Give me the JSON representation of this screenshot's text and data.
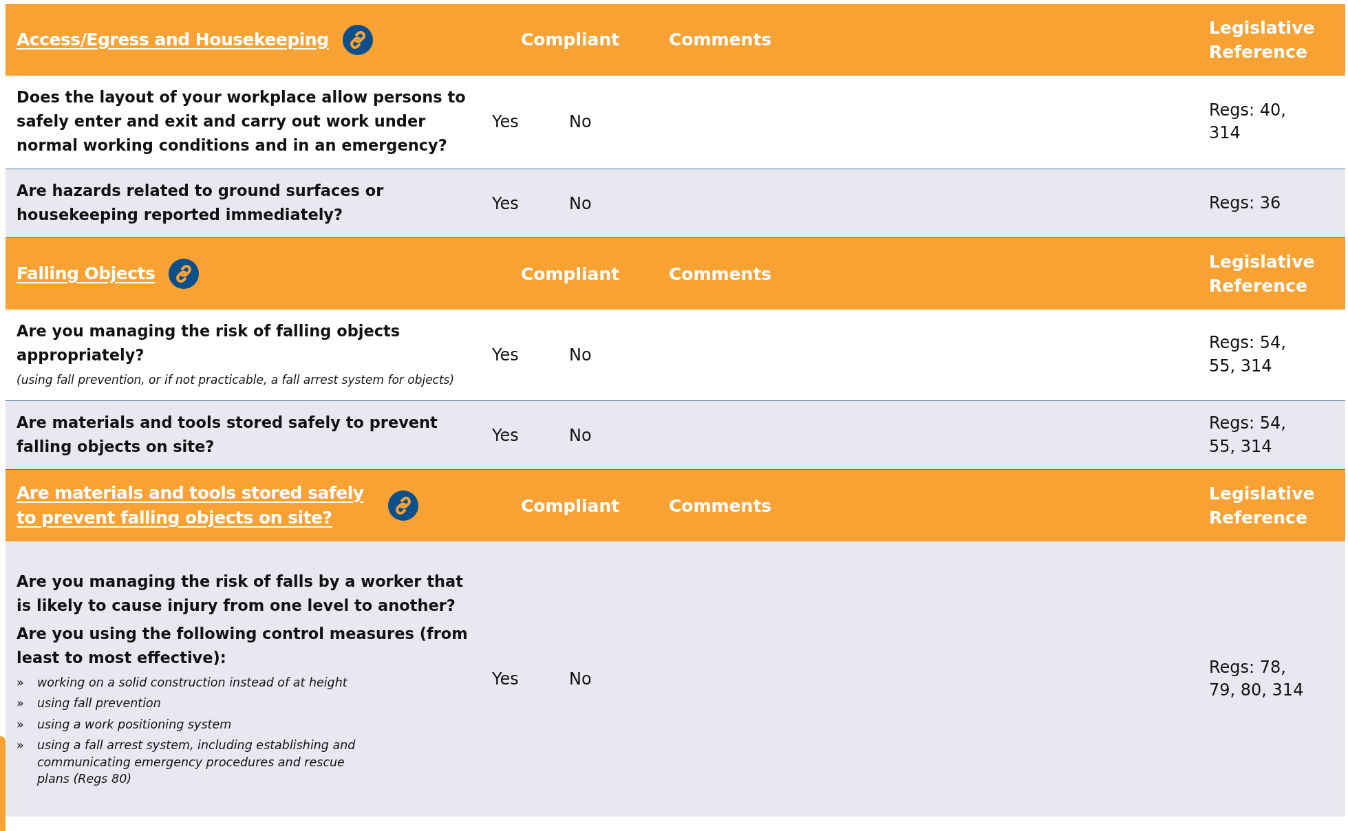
{
  "sections": [
    {
      "title": "Access/Egress and Housekeeping",
      "headers": {
        "compliant": "Compliant",
        "comments": "Comments",
        "reference": "Legislative Reference"
      },
      "rows": [
        {
          "shaded": false,
          "questions": [
            "Does the layout of your workplace allow persons to safely enter and exit and carry out work under normal working conditions and in an emergency?"
          ],
          "yes": "Yes",
          "no": "No",
          "reference": "Regs: 40, 314"
        },
        {
          "shaded": true,
          "questions": [
            "Are hazards related to ground surfaces or housekeeping reported immediately?"
          ],
          "yes": "Yes",
          "no": "No",
          "reference": "Regs: 36"
        }
      ]
    },
    {
      "title": "Falling Objects",
      "headers": {
        "compliant": "Compliant",
        "comments": "Comments",
        "reference": "Legislative Reference"
      },
      "rows": [
        {
          "shaded": false,
          "questions": [
            "Are you managing the risk of falling objects appropriately?"
          ],
          "note": "(using fall prevention, or if not practicable, a fall arrest system for objects)",
          "yes": "Yes",
          "no": "No",
          "reference": "Regs: 54, 55, 314"
        },
        {
          "shaded": true,
          "questions": [
            "Are materials and tools stored safely to prevent falling objects on site?"
          ],
          "yes": "Yes",
          "no": "No",
          "reference": "Regs: 54, 55, 314"
        }
      ]
    },
    {
      "title": "Are materials and tools stored safely to prevent falling objects on site?",
      "headers": {
        "compliant": "Compliant",
        "comments": "Comments",
        "reference": "Legislative Reference"
      },
      "rows": [
        {
          "shaded": true,
          "questions": [
            "Are you managing the risk of falls by a worker that is likely to cause injury from one level to another?",
            "Are you using the following control measures (from least to most effective):"
          ],
          "bullets": [
            {
              "marker": "»",
              "text": "working on a solid construction instead of at height"
            },
            {
              "marker": "»",
              "text": "using fall prevention"
            },
            {
              "marker": "»",
              "text": "using a work positioning system"
            },
            {
              "marker": "»",
              "text": "using a fall arrest system, including establishing and communicating emergency procedures and rescue plans (Regs 80)"
            }
          ],
          "yes": "Yes",
          "no": "No",
          "reference": "Regs: 78, 79, 80, 314"
        }
      ]
    }
  ]
}
